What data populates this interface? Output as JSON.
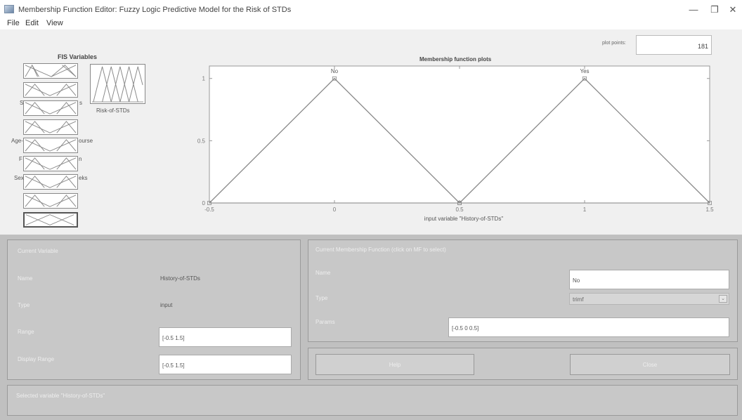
{
  "window": {
    "title": "Membership Function Editor: Fuzzy Logic Predictive Model for the Risk of STDs",
    "minimize_glyph": "—",
    "maximize_glyph": "❐",
    "close_glyph": "✕"
  },
  "menu": [
    "File",
    "Edit",
    "View"
  ],
  "fis": {
    "title": "FIS Variables",
    "input_label_fragments": [
      {
        "text": "S",
        "right": "s"
      },
      {
        "text": "Age-",
        "right": "ourse"
      },
      {
        "text": "F",
        "right": "n"
      },
      {
        "text": "Sex",
        "right": "eks"
      }
    ],
    "output_label": "Risk-of-STDs"
  },
  "plot": {
    "title": "Membership function plots",
    "plot_points_label": "plot points:",
    "plot_points_value": "181",
    "xlabel": "input variable \"History-of-STDs\""
  },
  "chart_data": {
    "type": "line",
    "title": "Membership function plots",
    "xlabel": "input variable \"History-of-STDs\"",
    "ylabel": "",
    "xlim": [
      -0.5,
      1.5
    ],
    "ylim": [
      0,
      1.1
    ],
    "xticks": [
      "-0.5",
      "0",
      "0.5",
      "1",
      "1.5"
    ],
    "yticks": [
      "0",
      "0.5",
      "1"
    ],
    "series": [
      {
        "name": "No",
        "x": [
          -0.5,
          0,
          0.5
        ],
        "y": [
          0,
          1,
          0
        ]
      },
      {
        "name": "Yes",
        "x": [
          0.5,
          1,
          1.5
        ],
        "y": [
          0,
          1,
          0
        ]
      }
    ]
  },
  "current_variable": {
    "section_title": "Current Variable",
    "name_label": "Name",
    "name_value": "History-of-STDs",
    "type_label": "Type",
    "type_value": "input",
    "range_label": "Range",
    "range_value": "[-0.5 1.5]",
    "display_range_label": "Display Range",
    "display_range_value": "[-0.5 1.5]"
  },
  "current_mf": {
    "section_title": "Current Membership Function (click on MF to select)",
    "name_label": "Name",
    "name_value": "No",
    "type_label": "Type",
    "type_value": "trimf",
    "params_label": "Params",
    "params_value": "[-0.5 0 0.5]"
  },
  "buttons": {
    "help": "Help",
    "close": "Close"
  },
  "status": "Selected variable \"History-of-STDs\"",
  "colors": {
    "mf_line": "#8a8a8a",
    "axis": "#999999",
    "panel_bg": "#c8c8c8"
  }
}
